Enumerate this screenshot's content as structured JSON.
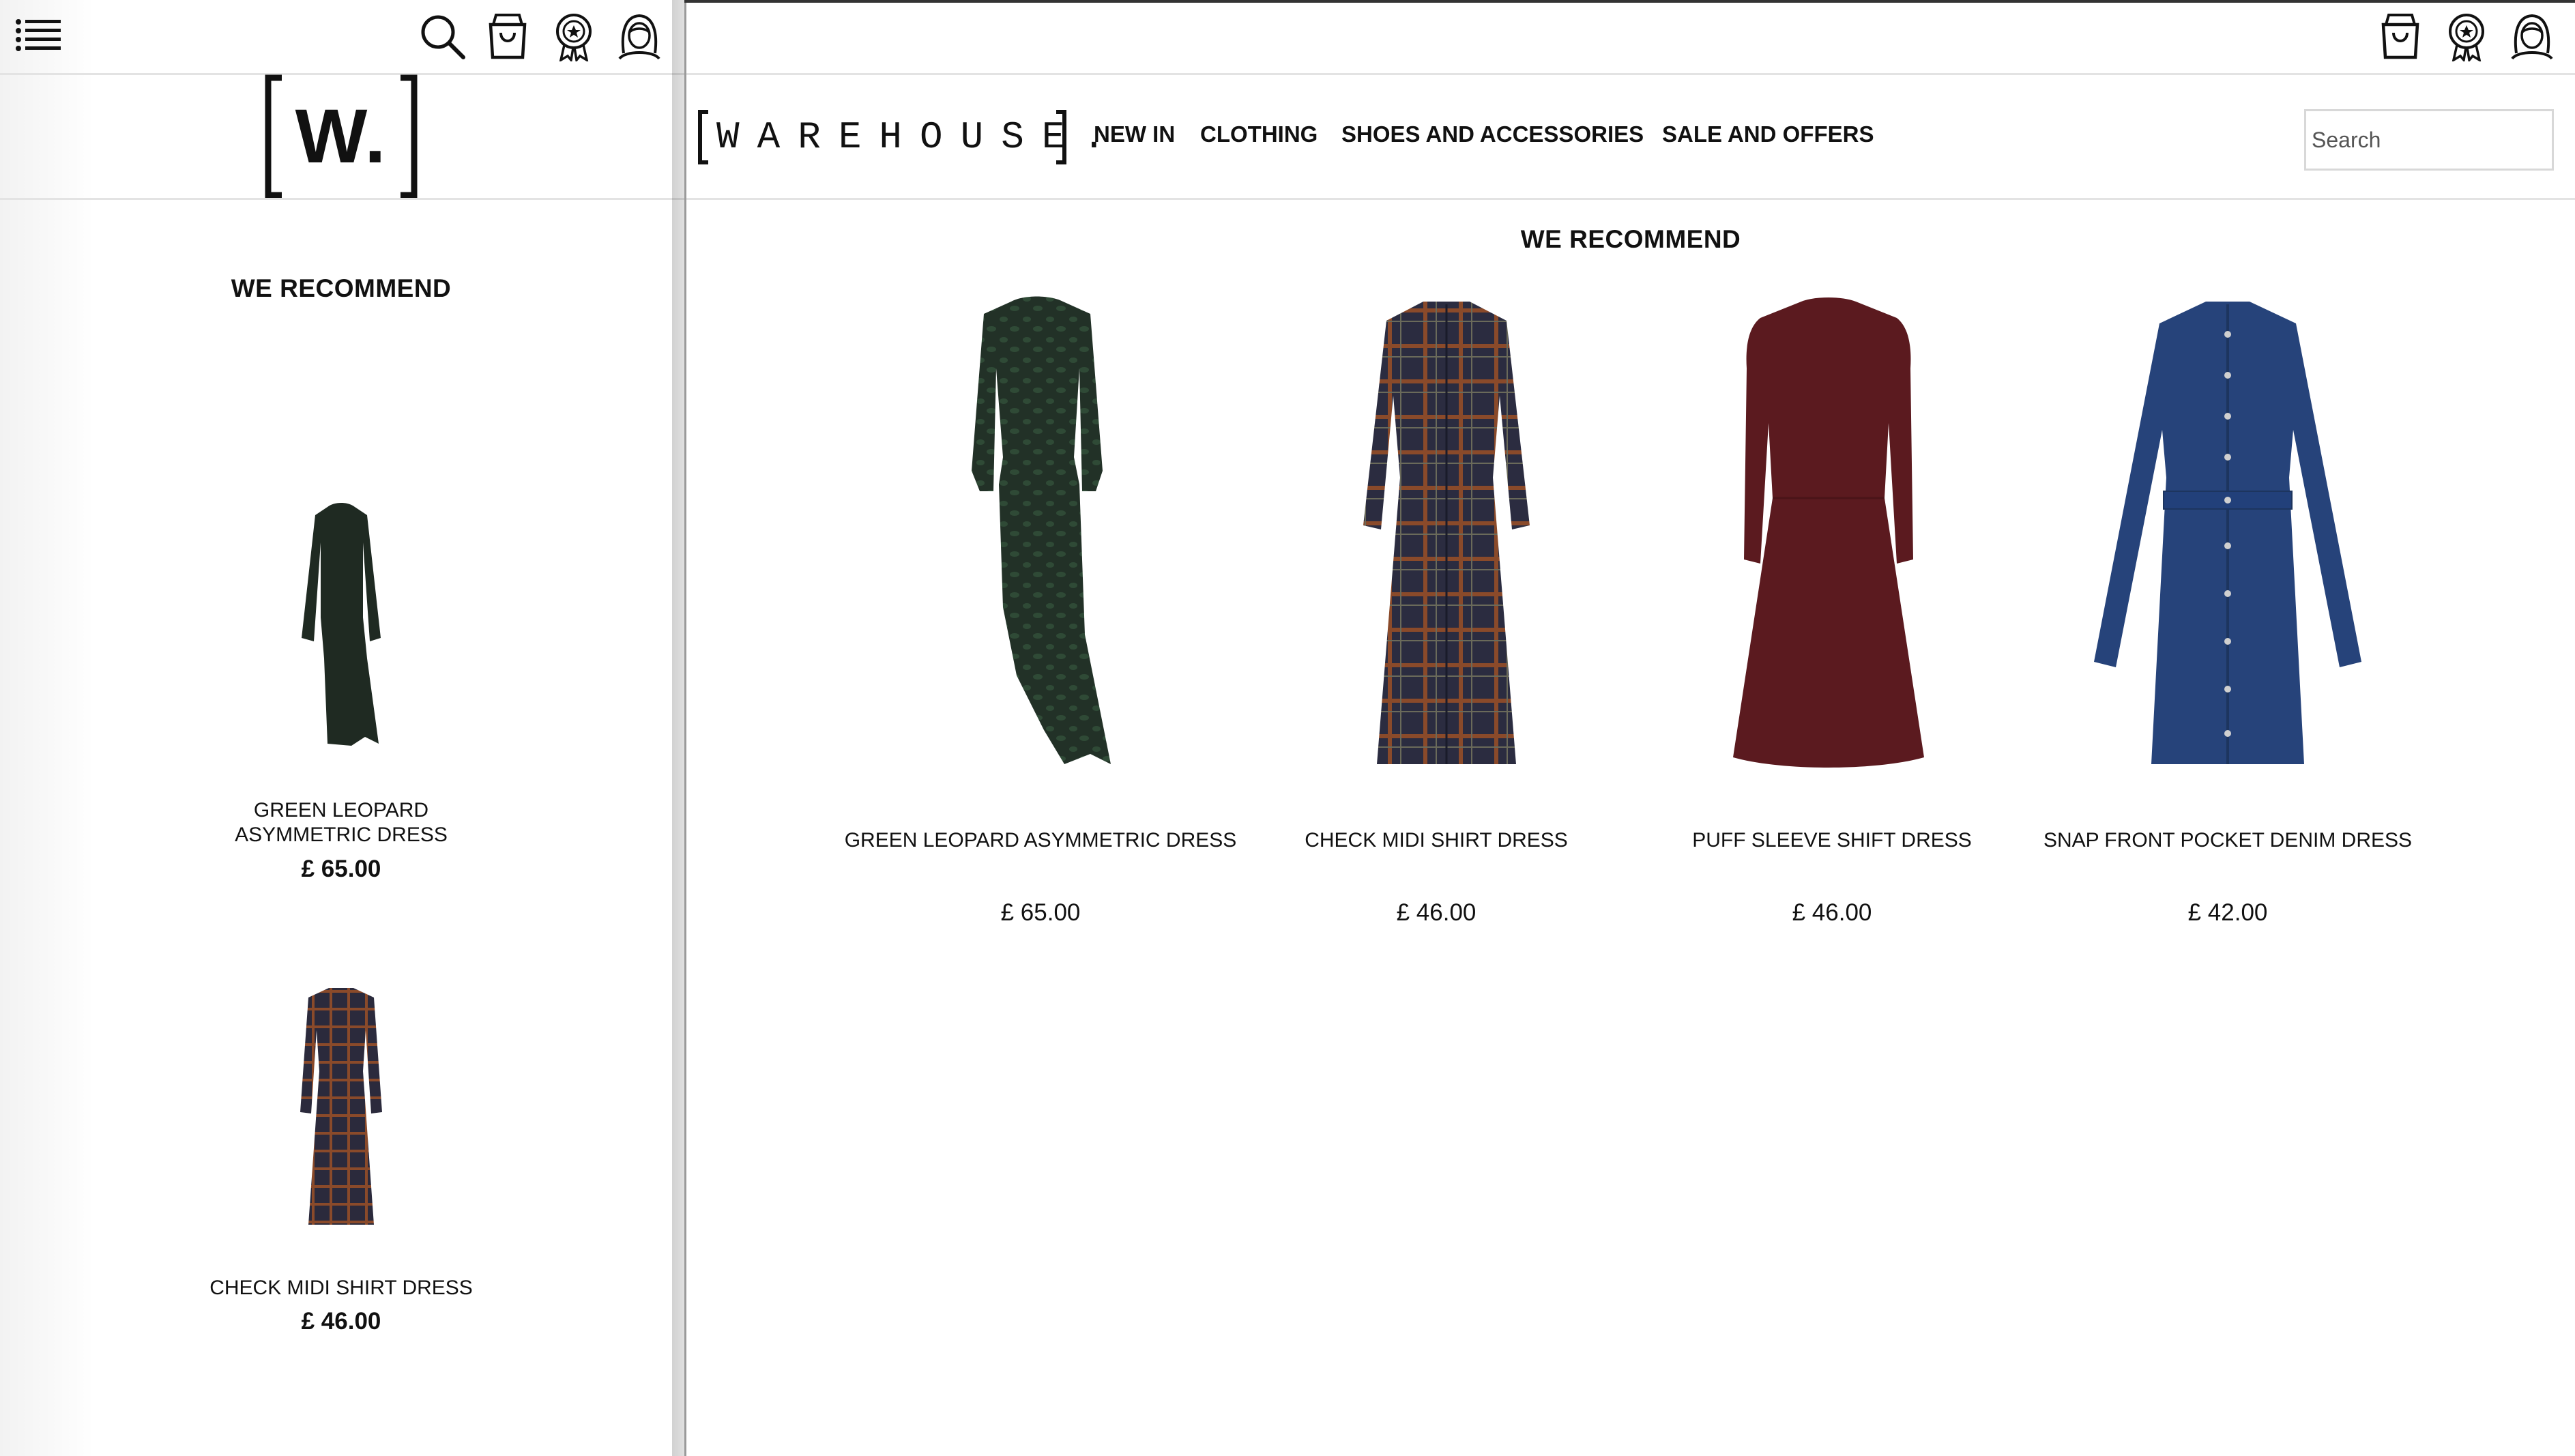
{
  "mobile": {
    "header_icons": [
      "menu-icon",
      "search-icon",
      "bag-icon",
      "rewards-icon",
      "account-icon"
    ],
    "logo_text": "W.",
    "section_title": "WE RECOMMEND",
    "products": [
      {
        "name": "GREEN LEOPARD ASYMMETRIC DRESS",
        "name_line1": "GREEN LEOPARD",
        "name_line2": "ASYMMETRIC DRESS",
        "price": "£ 65.00",
        "color": "#1f2a22"
      },
      {
        "name": "CHECK MIDI SHIRT DRESS",
        "price": "£ 46.00",
        "color": "#2b2a3c"
      }
    ]
  },
  "desktop": {
    "header_icons": [
      "bag-icon",
      "rewards-icon",
      "account-icon"
    ],
    "logo_text": "WAREHOUSE.",
    "nav": [
      "NEW IN",
      "CLOTHING",
      "SHOES AND ACCESSORIES",
      "SALE AND OFFERS"
    ],
    "search_placeholder": "Search",
    "section_title": "WE RECOMMEND",
    "products": [
      {
        "name": "GREEN LEOPARD ASYMMETRIC DRESS",
        "price": "£ 65.00",
        "color": "#223127"
      },
      {
        "name": "CHECK MIDI SHIRT DRESS",
        "price": "£ 46.00",
        "color": "#2b2c40"
      },
      {
        "name": "PUFF SLEEVE SHIFT DRESS",
        "price": "£ 46.00",
        "color": "#5b1a1f"
      },
      {
        "name": "SNAP FRONT POCKET DENIM DRESS",
        "price": "£ 42.00",
        "color": "#26437a"
      }
    ]
  }
}
